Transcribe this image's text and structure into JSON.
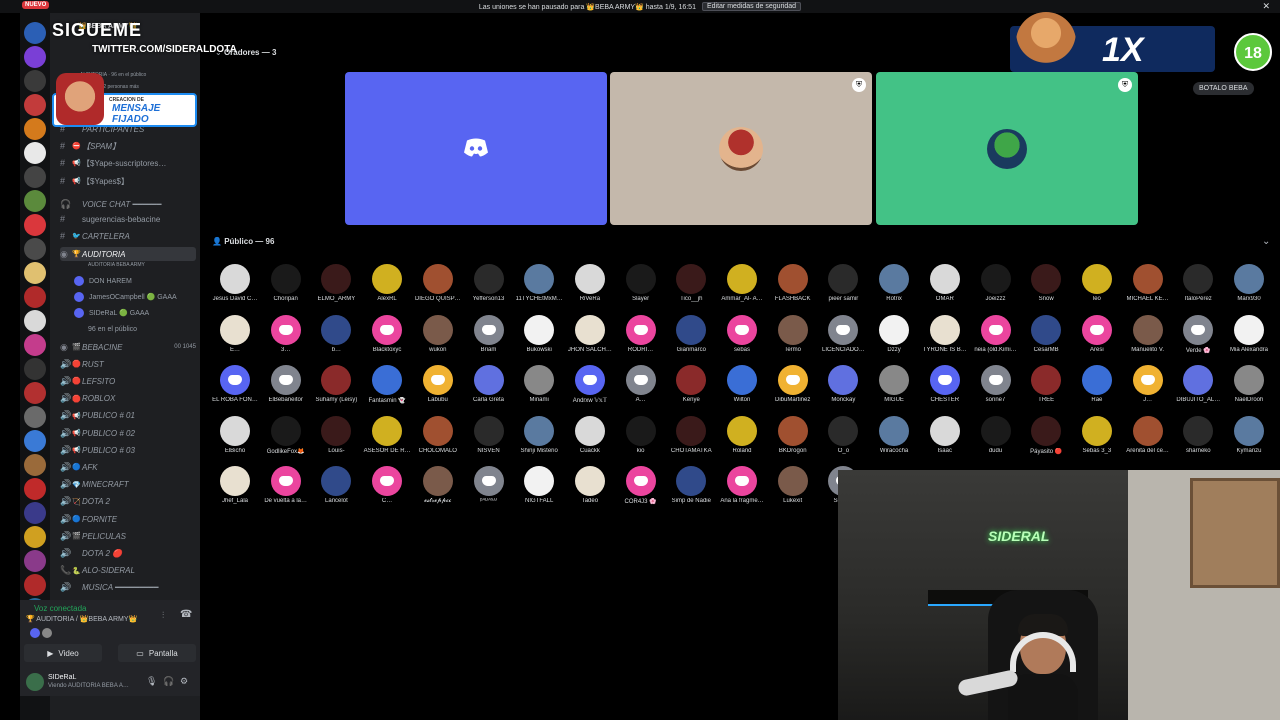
{
  "topbar": {
    "badge": "NUEVO",
    "text": "Las uniones se han pausado para 👑BEBA ARMY👑 hasta 1/9, 16:51",
    "button": "Editar medidas de seguridad"
  },
  "overlay": {
    "follow": "SIGUEME",
    "twitter": "TWITTER.COM/SIDERALDOTA",
    "pinned_top": "CREACION DE",
    "pinned_title": "MENSAJE FIJADO"
  },
  "server": {
    "name": "BEBA ARMY",
    "sub": "AUDITORIA · 96 en el público",
    "sub2": "HAREM y 2 personas más"
  },
  "channels": [
    {
      "icon": "#",
      "emoji": "",
      "label": "PARTICIPANTES"
    },
    {
      "icon": "#",
      "emoji": "⛔",
      "label": "【SPAM】"
    },
    {
      "icon": "#",
      "emoji": "📢",
      "label": "【$Yape-suscriptores…"
    },
    {
      "icon": "#",
      "emoji": "📢",
      "label": "【$Yapes$】"
    },
    {
      "icon": "🎧",
      "emoji": "",
      "label": "VOICE CHAT ━━━━━━"
    },
    {
      "icon": "#",
      "emoji": "",
      "label": "sugerencias-bebacine"
    },
    {
      "icon": "#",
      "emoji": "🐦",
      "label": "CARTELERA"
    },
    {
      "icon": "◉",
      "emoji": "🏆",
      "label": "AUDITORIA"
    }
  ],
  "active_sub": "AUDITORIA BEBA ARMY",
  "voice_users": [
    "DON HAREM",
    "JamesOCampbell 🟢 GAAA",
    "SIDeRaL 🟢 GAAA",
    "96 en el público"
  ],
  "channels2": [
    {
      "icon": "◉",
      "emoji": "🎬",
      "label": "BEBACINE",
      "tag": "00  1045"
    },
    {
      "icon": "🔊",
      "emoji": "🛑",
      "label": "RUST"
    },
    {
      "icon": "🔊",
      "emoji": "🛑",
      "label": "LEFSITO"
    },
    {
      "icon": "🔊",
      "emoji": "🛑",
      "label": "ROBLOX"
    },
    {
      "icon": "🔊",
      "emoji": "📢",
      "label": "PUBLICO # 01"
    },
    {
      "icon": "🔊",
      "emoji": "📢",
      "label": "PUBLICO # 02"
    },
    {
      "icon": "🔊",
      "emoji": "📢",
      "label": "PUBLICO # 03"
    },
    {
      "icon": "🔊",
      "emoji": "🔵",
      "label": "AFK"
    },
    {
      "icon": "🔊",
      "emoji": "💎",
      "label": "MINECRAFT"
    },
    {
      "icon": "🔊",
      "emoji": "🏹",
      "label": "DOTA 2"
    },
    {
      "icon": "🔊",
      "emoji": "🔵",
      "label": "FORNITE"
    },
    {
      "icon": "🔊",
      "emoji": "🎬",
      "label": "PELICULAS"
    },
    {
      "icon": "🔊",
      "emoji": "",
      "label": "DOTA 2 🔴"
    },
    {
      "icon": "📞",
      "emoji": "🐍",
      "label": "ALO-SIDERAL"
    },
    {
      "icon": "🔊",
      "emoji": "",
      "label": "MUSICA ━━━━━━━━━"
    }
  ],
  "voice_panel": {
    "status": "Voz conectada",
    "channel": "🏆 AUDITORIA / 👑BEBA ARMY👑",
    "video": "Video",
    "screen": "Pantalla"
  },
  "userbar": {
    "name": "SIDeRaL",
    "status": "Viendo AUDITORIA BEBA A…"
  },
  "main": {
    "speakers_header": "Oradores — 3",
    "audience_header": "Público — 96",
    "botalo": "BOTALO BEBA"
  },
  "sponsor": {
    "logo": "1X",
    "age": "18"
  },
  "webcam": {
    "neon": "SIDERAL"
  },
  "audience": [
    [
      "Jesus David C…",
      "Choripan",
      "ELMO_ARMY",
      "AlexRL",
      "DIEGO QUISP…",
      "Yefferson13",
      "11TYCHEtMxM…",
      "RiVeRa",
      "Slayer",
      "Tico__jh",
      "Ammar_Al- A…",
      "FLASHBACK",
      "pieer samir",
      "Rotrix",
      "OMAR",
      "Joeizzz",
      "Snow",
      "leo",
      "MICHAEL KE…",
      "ItaloPérez",
      "Marx930"
    ],
    [
      "E…",
      "3…",
      "b…",
      "Blacktoxyc",
      "wukon",
      "Briam",
      "Bukowski",
      "JHON SALCH…",
      "RODRI…",
      "Gianmarco",
      "sebas",
      "Termo",
      "LICENCIADO…",
      "Dzzy",
      "TYRONE IS B…",
      "neia (old.Kimi…",
      "CesarMB",
      "Aresi",
      "Manuelito V.",
      "Verde 🌸",
      "Mia Alexandra"
    ],
    [
      "EL ROBA FON…",
      "ElBebaneitor",
      "Suhamy (Leisy)",
      "Fantasmin 👻",
      "Labubu",
      "Carla Greta",
      "Minami",
      "Andrxw 𝕍𝕩𝕋",
      "A…",
      "Kenye",
      "Wilton",
      "DibuMartinez",
      "Monckay",
      "MIGUE",
      "CHESTER",
      "sonne7",
      "TREE",
      "Rae",
      "J…",
      "DIBUJITO_AL…",
      "NaelDrooh"
    ],
    [
      "ElBicho",
      "GodlikeFox🦊",
      "Louis-",
      "ASESOR DE R…",
      "CHOLOMALO",
      "NISVEN",
      "Shinji Misterio",
      "Cuackk",
      "kio",
      "CHOTAMATKA",
      "Roland",
      "BKDrogon",
      "O_o",
      "Wiracocha",
      "Isaac",
      "dudu",
      "Páyasito 🔴",
      "Sebas 3_3",
      "Arenita del ce…",
      "sharneko",
      "Kymanzu"
    ],
    [
      "Jhef_Lala",
      "De vuelta a la…",
      "Lancelot",
      "C…",
      "𝓮𝓼𝓽𝓻𝓮𝓹𝓹𝓬𝓬",
      "ᵖᴬᴸᴵᴬˢᴶᴶ",
      "NIGTFALL",
      "Tadeo",
      "COR4J3 🌸",
      "Simp de Nadie",
      "Ana la fragme…",
      "Lukexit",
      "SrCh…"
    ]
  ],
  "colors": {
    "discord_blurple": "#5865f2",
    "speaker2_bg": "#c4b8ab",
    "speaker3_bg": "#43c286",
    "green_status": "#23a55a",
    "red_badge": "#da373c"
  }
}
